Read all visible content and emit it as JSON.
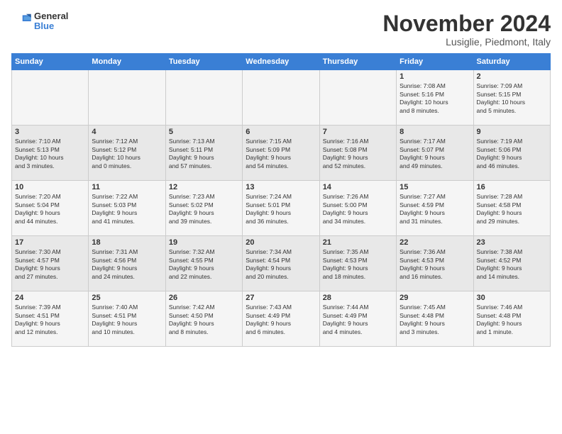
{
  "logo": {
    "general": "General",
    "blue": "Blue"
  },
  "title": "November 2024",
  "location": "Lusiglie, Piedmont, Italy",
  "days_of_week": [
    "Sunday",
    "Monday",
    "Tuesday",
    "Wednesday",
    "Thursday",
    "Friday",
    "Saturday"
  ],
  "weeks": [
    [
      {
        "day": "",
        "info": ""
      },
      {
        "day": "",
        "info": ""
      },
      {
        "day": "",
        "info": ""
      },
      {
        "day": "",
        "info": ""
      },
      {
        "day": "",
        "info": ""
      },
      {
        "day": "1",
        "info": "Sunrise: 7:08 AM\nSunset: 5:16 PM\nDaylight: 10 hours\nand 8 minutes."
      },
      {
        "day": "2",
        "info": "Sunrise: 7:09 AM\nSunset: 5:15 PM\nDaylight: 10 hours\nand 5 minutes."
      }
    ],
    [
      {
        "day": "3",
        "info": "Sunrise: 7:10 AM\nSunset: 5:13 PM\nDaylight: 10 hours\nand 3 minutes."
      },
      {
        "day": "4",
        "info": "Sunrise: 7:12 AM\nSunset: 5:12 PM\nDaylight: 10 hours\nand 0 minutes."
      },
      {
        "day": "5",
        "info": "Sunrise: 7:13 AM\nSunset: 5:11 PM\nDaylight: 9 hours\nand 57 minutes."
      },
      {
        "day": "6",
        "info": "Sunrise: 7:15 AM\nSunset: 5:09 PM\nDaylight: 9 hours\nand 54 minutes."
      },
      {
        "day": "7",
        "info": "Sunrise: 7:16 AM\nSunset: 5:08 PM\nDaylight: 9 hours\nand 52 minutes."
      },
      {
        "day": "8",
        "info": "Sunrise: 7:17 AM\nSunset: 5:07 PM\nDaylight: 9 hours\nand 49 minutes."
      },
      {
        "day": "9",
        "info": "Sunrise: 7:19 AM\nSunset: 5:06 PM\nDaylight: 9 hours\nand 46 minutes."
      }
    ],
    [
      {
        "day": "10",
        "info": "Sunrise: 7:20 AM\nSunset: 5:04 PM\nDaylight: 9 hours\nand 44 minutes."
      },
      {
        "day": "11",
        "info": "Sunrise: 7:22 AM\nSunset: 5:03 PM\nDaylight: 9 hours\nand 41 minutes."
      },
      {
        "day": "12",
        "info": "Sunrise: 7:23 AM\nSunset: 5:02 PM\nDaylight: 9 hours\nand 39 minutes."
      },
      {
        "day": "13",
        "info": "Sunrise: 7:24 AM\nSunset: 5:01 PM\nDaylight: 9 hours\nand 36 minutes."
      },
      {
        "day": "14",
        "info": "Sunrise: 7:26 AM\nSunset: 5:00 PM\nDaylight: 9 hours\nand 34 minutes."
      },
      {
        "day": "15",
        "info": "Sunrise: 7:27 AM\nSunset: 4:59 PM\nDaylight: 9 hours\nand 31 minutes."
      },
      {
        "day": "16",
        "info": "Sunrise: 7:28 AM\nSunset: 4:58 PM\nDaylight: 9 hours\nand 29 minutes."
      }
    ],
    [
      {
        "day": "17",
        "info": "Sunrise: 7:30 AM\nSunset: 4:57 PM\nDaylight: 9 hours\nand 27 minutes."
      },
      {
        "day": "18",
        "info": "Sunrise: 7:31 AM\nSunset: 4:56 PM\nDaylight: 9 hours\nand 24 minutes."
      },
      {
        "day": "19",
        "info": "Sunrise: 7:32 AM\nSunset: 4:55 PM\nDaylight: 9 hours\nand 22 minutes."
      },
      {
        "day": "20",
        "info": "Sunrise: 7:34 AM\nSunset: 4:54 PM\nDaylight: 9 hours\nand 20 minutes."
      },
      {
        "day": "21",
        "info": "Sunrise: 7:35 AM\nSunset: 4:53 PM\nDaylight: 9 hours\nand 18 minutes."
      },
      {
        "day": "22",
        "info": "Sunrise: 7:36 AM\nSunset: 4:53 PM\nDaylight: 9 hours\nand 16 minutes."
      },
      {
        "day": "23",
        "info": "Sunrise: 7:38 AM\nSunset: 4:52 PM\nDaylight: 9 hours\nand 14 minutes."
      }
    ],
    [
      {
        "day": "24",
        "info": "Sunrise: 7:39 AM\nSunset: 4:51 PM\nDaylight: 9 hours\nand 12 minutes."
      },
      {
        "day": "25",
        "info": "Sunrise: 7:40 AM\nSunset: 4:51 PM\nDaylight: 9 hours\nand 10 minutes."
      },
      {
        "day": "26",
        "info": "Sunrise: 7:42 AM\nSunset: 4:50 PM\nDaylight: 9 hours\nand 8 minutes."
      },
      {
        "day": "27",
        "info": "Sunrise: 7:43 AM\nSunset: 4:49 PM\nDaylight: 9 hours\nand 6 minutes."
      },
      {
        "day": "28",
        "info": "Sunrise: 7:44 AM\nSunset: 4:49 PM\nDaylight: 9 hours\nand 4 minutes."
      },
      {
        "day": "29",
        "info": "Sunrise: 7:45 AM\nSunset: 4:48 PM\nDaylight: 9 hours\nand 3 minutes."
      },
      {
        "day": "30",
        "info": "Sunrise: 7:46 AM\nSunset: 4:48 PM\nDaylight: 9 hours\nand 1 minute."
      }
    ]
  ]
}
